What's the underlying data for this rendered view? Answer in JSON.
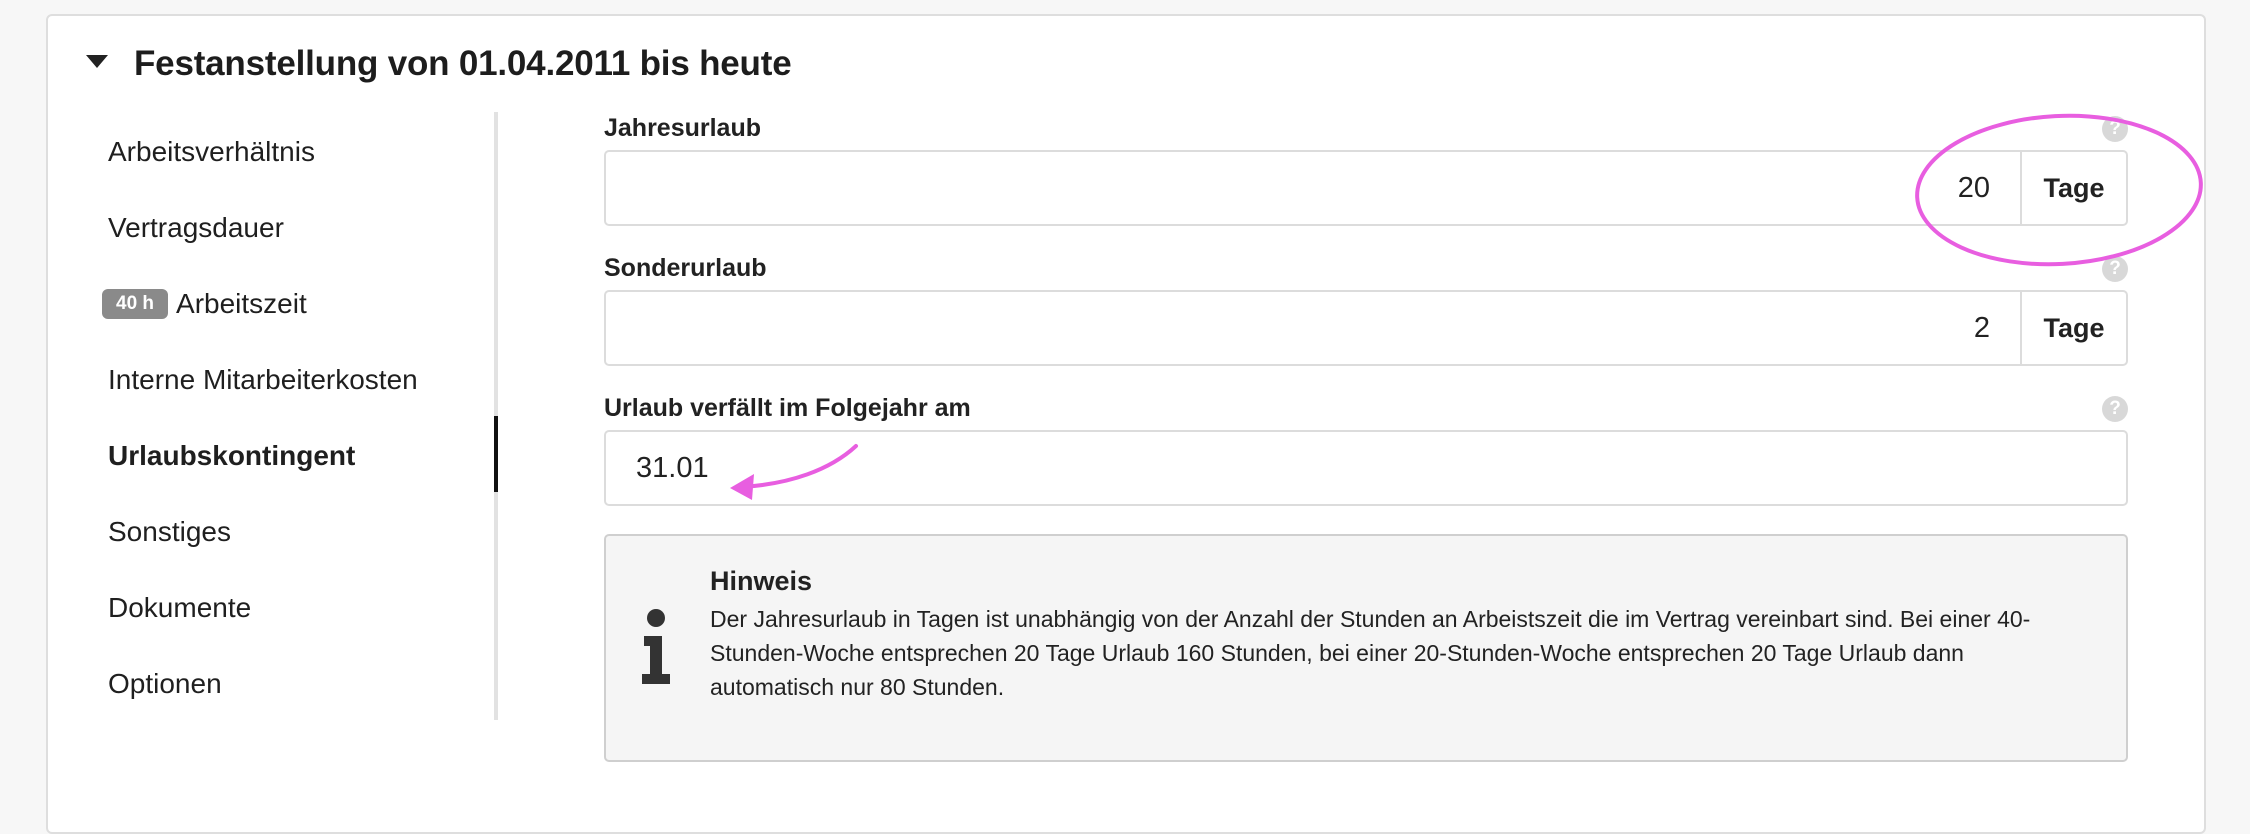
{
  "section": {
    "title": "Festanstellung von 01.04.2011 bis heute"
  },
  "nav": {
    "items": [
      {
        "label": "Arbeitsverhältnis"
      },
      {
        "label": "Vertragsdauer"
      },
      {
        "label": "Arbeitszeit",
        "badge": "40 h"
      },
      {
        "label": "Interne Mitarbeiterkosten"
      },
      {
        "label": "Urlaubskontingent",
        "active": true
      },
      {
        "label": "Sonstiges"
      },
      {
        "label": "Dokumente"
      },
      {
        "label": "Optionen"
      }
    ]
  },
  "form": {
    "jahresurlaub": {
      "label": "Jahresurlaub",
      "value": "20",
      "unit": "Tage",
      "help": "?"
    },
    "sonderurlaub": {
      "label": "Sonderurlaub",
      "value": "2",
      "unit": "Tage",
      "help": "?"
    },
    "verfall": {
      "label": "Urlaub verfällt im Folgejahr am",
      "value": "31.01",
      "help": "?"
    }
  },
  "notice": {
    "title": "Hinweis",
    "text": "Der Jahresurlaub in Tagen ist unabhängig von der Anzahl der Stunden an Arbeistszeit die im Vertrag vereinbart sind. Bei einer 40-Stunden-Woche entsprechen 20 Tage Urlaub 160 Stunden, bei einer 20-Stunden-Woche entsprechen 20 Tage Urlaub dann automatisch nur 80 Stunden."
  },
  "colors": {
    "annotation": "#e85ee0",
    "badge": "#8a8a8a",
    "active_rail": "#111111"
  },
  "icons": {
    "section_toggle": "caret-down-icon",
    "help": "question-circle-icon",
    "notice": "info-icon"
  }
}
